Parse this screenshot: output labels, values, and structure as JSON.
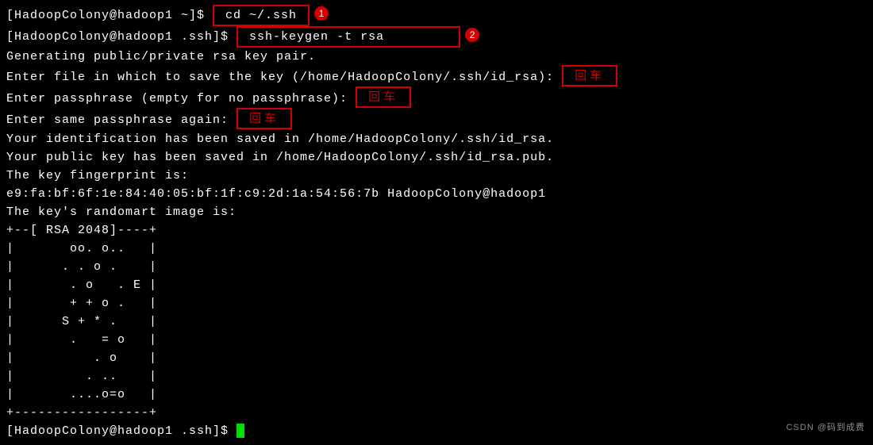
{
  "prompts": {
    "p1": "[HadoopColony@hadoop1 ~]$ ",
    "p2": "[HadoopColony@hadoop1 .ssh]$ ",
    "p3": "[HadoopColony@hadoop1 .ssh]$ "
  },
  "commands": {
    "cd": " cd ~/.ssh ",
    "keygen": " ssh-keygen -t rsa         "
  },
  "badges": {
    "b1": "1",
    "b2": "2"
  },
  "annotations": {
    "enter1": "回车",
    "enter2": "回车",
    "enter3": "回车"
  },
  "output": {
    "l1": "Generating public/private rsa key pair.",
    "l2a": "Enter file in which to save the key (/home/HadoopColony/.ssh/id_rsa): ",
    "l3a": "Enter passphrase (empty for no passphrase): ",
    "l4a": "Enter same passphrase again: ",
    "l5": "Your identification has been saved in /home/HadoopColony/.ssh/id_rsa.",
    "l6": "Your public key has been saved in /home/HadoopColony/.ssh/id_rsa.pub.",
    "l7": "The key fingerprint is:",
    "l8": "e9:fa:bf:6f:1e:84:40:05:bf:1f:c9:2d:1a:54:56:7b HadoopColony@hadoop1",
    "l9": "The key's randomart image is:",
    "art": [
      "+--[ RSA 2048]----+",
      "|       oo. o..   |",
      "|      . . o .    |",
      "|       . o   . E |",
      "|       + + o .   |",
      "|      S + * .    |",
      "|       .   = o   |",
      "|          . o    |",
      "|         . ..    |",
      "|       ....o=o   |",
      "+-----------------+"
    ]
  },
  "watermark": "CSDN @码到成费",
  "colors": {
    "annotation": "#d00000",
    "cursor": "#00e000",
    "bg": "#000000",
    "fg": "#ffffff"
  }
}
